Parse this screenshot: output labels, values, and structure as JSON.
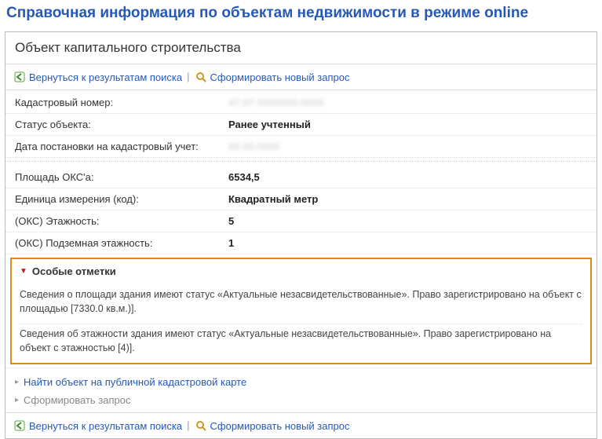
{
  "page_title": "Справочная информация по объектам недвижимости в режиме online",
  "subhead": "Объект капитального строительства",
  "toolbar": {
    "back_label": "Вернуться к результатам поиска",
    "new_query_label": "Сформировать новый запрос"
  },
  "props": {
    "cad_number_label": "Кадастровый номер:",
    "cad_number_value": "47:07:0000000:0000",
    "status_label": "Статус объекта:",
    "status_value": "Ранее учтенный",
    "reg_date_label": "Дата постановки на кадастровый учет:",
    "reg_date_value": "00.00.0000",
    "area_label": "Площадь ОКС'а:",
    "area_value": "6534,5",
    "unit_label": "Единица измерения (код):",
    "unit_value": "Квадратный метр",
    "floors_label": "(ОКС) Этажность:",
    "floors_value": "5",
    "under_floors_label": "(ОКС) Подземная этажность:",
    "under_floors_value": "1"
  },
  "special": {
    "heading": "Особые отметки",
    "note1": "Сведения о площади здания имеют статус «Актуальные незасвидетельствованные». Право зарегистрировано на объект с площадью [7330.0 кв.м.)].",
    "note2": "Сведения об этажности здания имеют статус «Актуальные незасвидетельствованные». Право зарегистрировано на объект с этажностью [4)]."
  },
  "footer": {
    "find_on_map": "Найти объект на публичной кадастровой карте",
    "form_query": "Сформировать запрос",
    "back_label": "Вернуться к результатам поиска",
    "new_query_label": "Сформировать новый запрос"
  }
}
